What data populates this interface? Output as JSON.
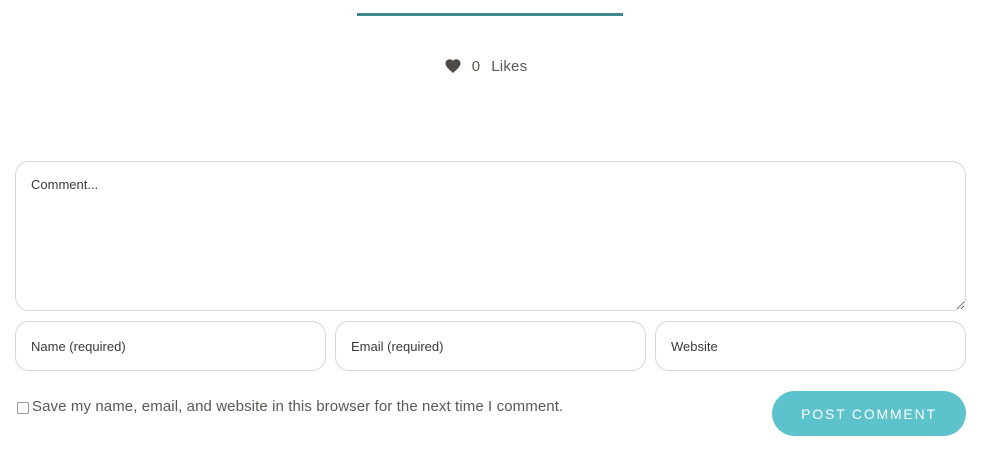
{
  "colors": {
    "accent_line": "#3f8a8f",
    "button_bg": "#5cc2cc",
    "button_text": "#ffffff",
    "heart": "#4f4a46"
  },
  "likes": {
    "icon": "heart-icon",
    "count": "0",
    "label": "Likes"
  },
  "comment_form": {
    "comment_placeholder": "Comment...",
    "name_placeholder": "Name (required)",
    "email_placeholder": "Email (required)",
    "website_placeholder": "Website",
    "save_info_label": "Save my name, email, and website in this browser for the next time I comment.",
    "submit_label": "POST COMMENT"
  }
}
